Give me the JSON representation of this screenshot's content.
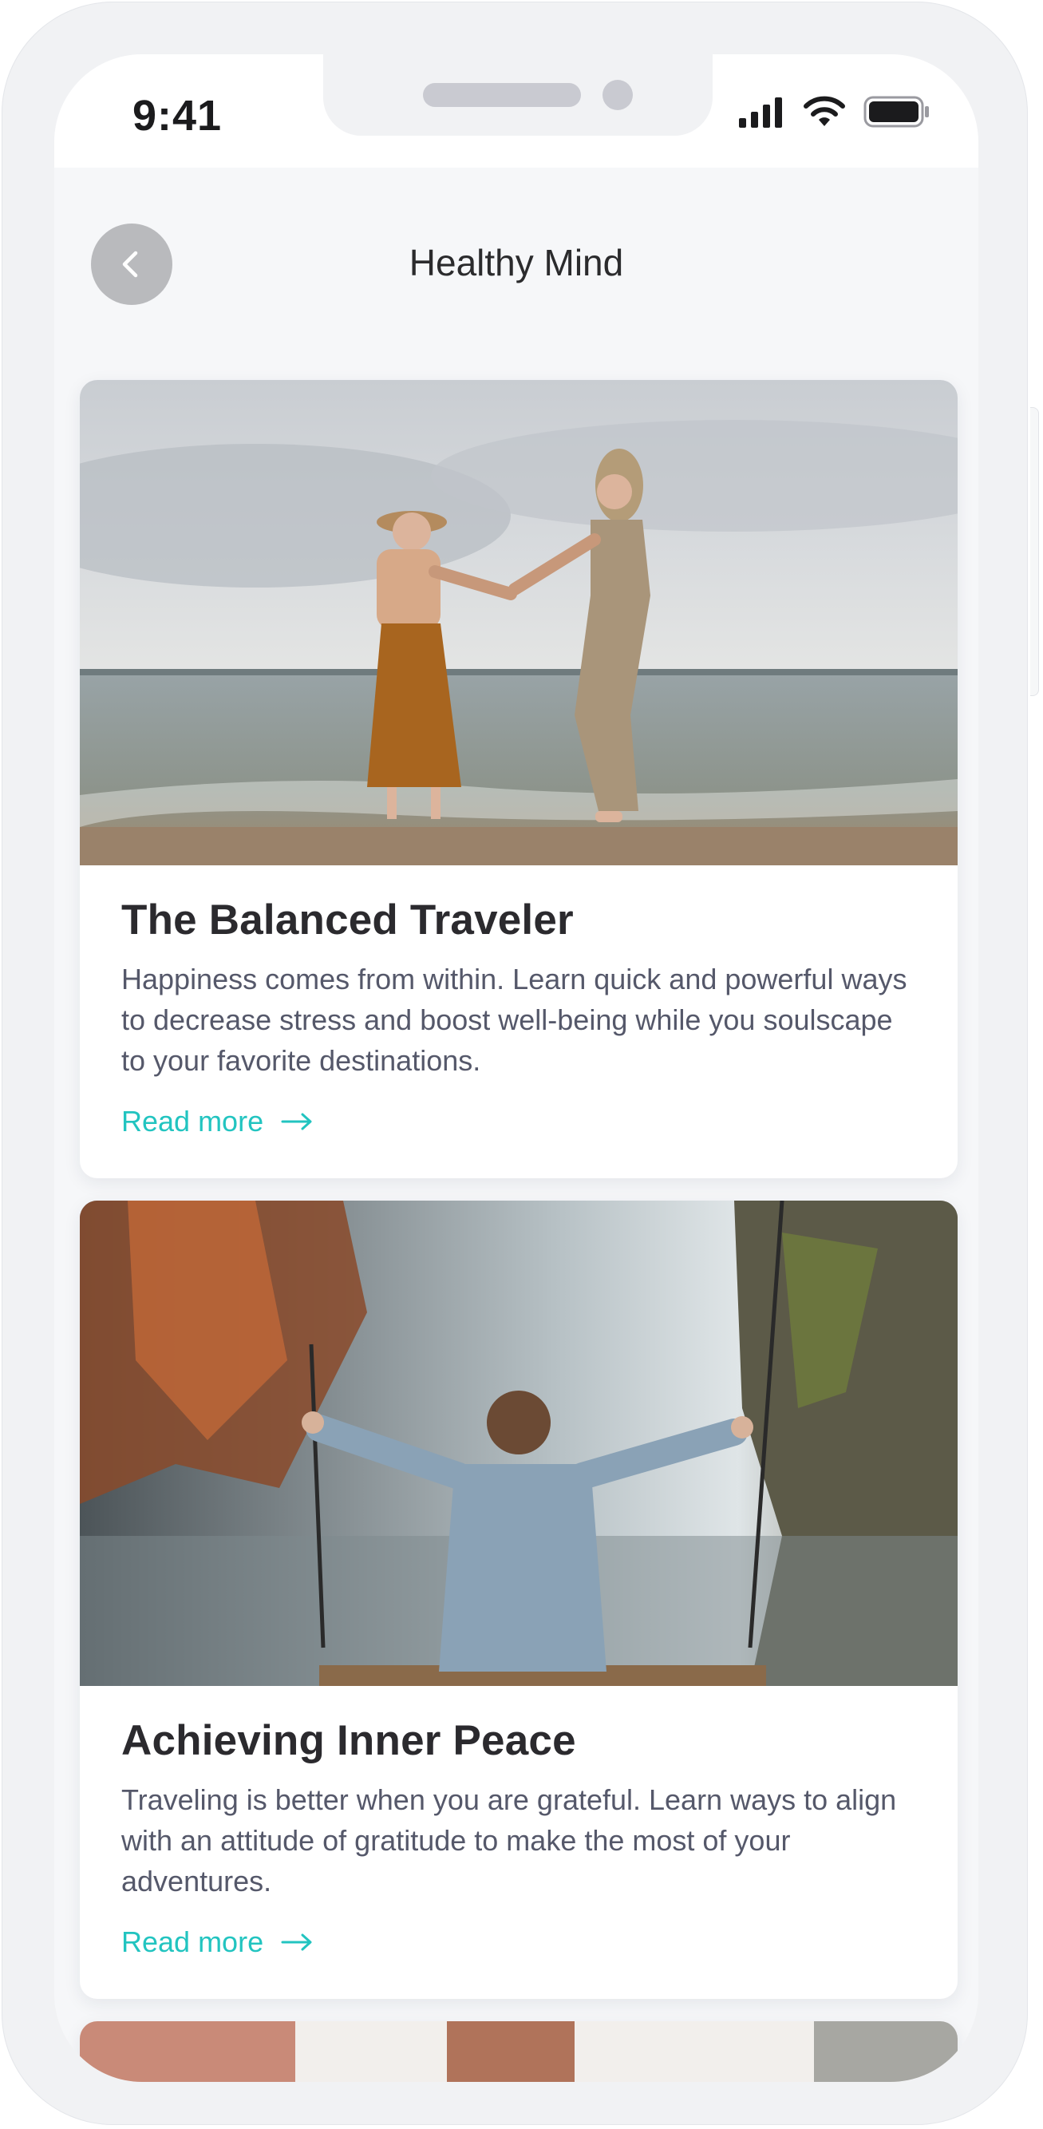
{
  "status_bar": {
    "time": "9:41"
  },
  "header": {
    "title": "Healthy Mind"
  },
  "articles": [
    {
      "title": "The Balanced Traveler",
      "description": "Happiness comes from within. Learn quick and powerful ways to decrease stress and boost well-being while you soulscape to your favorite destinations.",
      "link_label": "Read more",
      "image": "two-women-dancing-on-beach"
    },
    {
      "title": "Achieving Inner Peace",
      "description": "Traveling is better when you are grateful. Learn ways to align with an attitude of gratitude to make the most of your adventures.",
      "link_label": "Read more",
      "image": "woman-on-swing-by-waterfall"
    }
  ],
  "colors": {
    "accent": "#22c4c0",
    "title": "#2b2a2e",
    "body_text": "#55586a",
    "back_button": "#b9babd"
  },
  "icons": [
    "back-chevron-icon",
    "signal-icon",
    "wifi-icon",
    "battery-icon",
    "arrow-right-icon"
  ]
}
